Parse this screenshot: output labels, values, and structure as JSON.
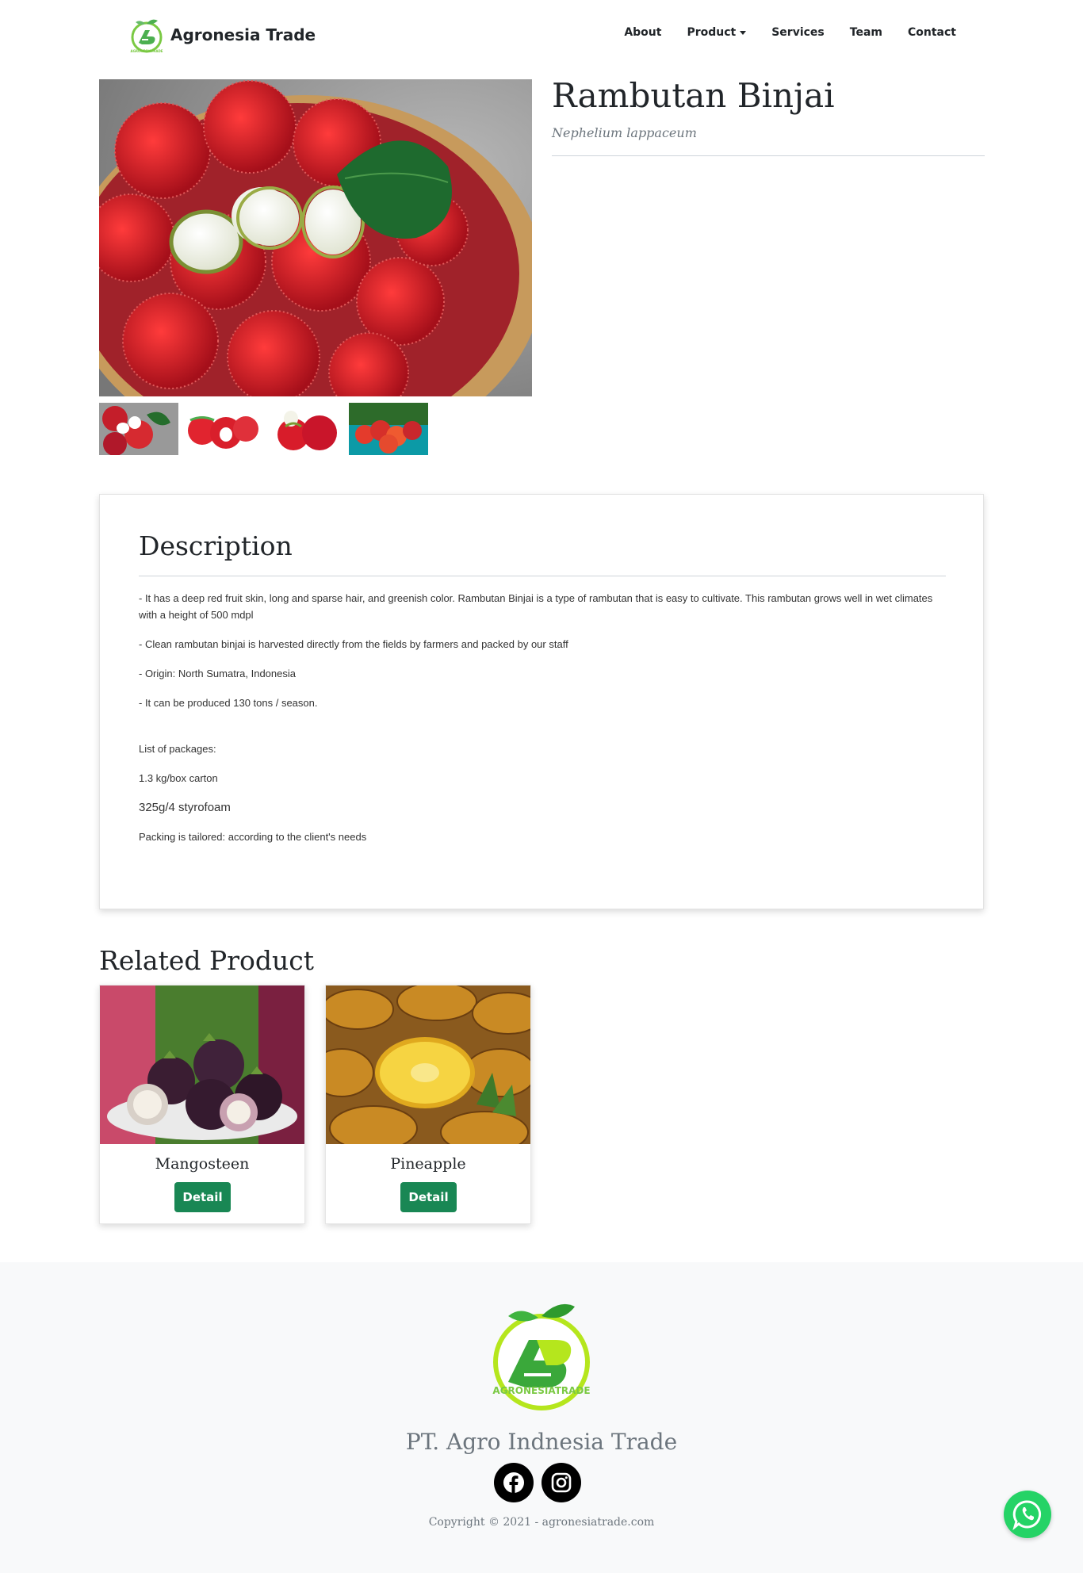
{
  "navbar": {
    "brand_name": "Agronesia Trade",
    "items": [
      {
        "label": "About"
      },
      {
        "label": "Product",
        "dropdown": true
      },
      {
        "label": "Services"
      },
      {
        "label": "Team"
      },
      {
        "label": "Contact"
      }
    ]
  },
  "product": {
    "title": "Rambutan Binjai",
    "latin_name": "Nephelium lappaceum",
    "thumbnails_count": 4
  },
  "description": {
    "heading": "Description",
    "paragraphs": [
      "- It has a deep red fruit skin, long and sparse hair, and greenish color. Rambutan Binjai is a type of rambutan that is easy to cultivate. This rambutan grows well in wet climates with a height of 500 mdpl",
      "- Clean rambutan binjai is harvested directly from the fields by farmers and packed by our staff",
      "- Origin: North Sumatra, Indonesia",
      "- It can be produced 130 tons / season."
    ],
    "packages_title": "List of packages:",
    "packages": [
      "1.3 kg/box carton",
      "325g/4 styrofoam",
      "Packing is tailored: according to the client's needs"
    ]
  },
  "related": {
    "heading": "Related Product",
    "items": [
      {
        "name": "Mangosteen",
        "button": "Detail"
      },
      {
        "name": "Pineapple",
        "button": "Detail"
      }
    ]
  },
  "footer": {
    "logo_text": "AGRONESIATRADE",
    "company": "PT. Agro Indnesia Trade",
    "copyright": "Copyright © 2021 - agronesiatrade.com",
    "socials": [
      "facebook-icon",
      "instagram-icon"
    ]
  },
  "colors": {
    "primary_green": "#198754",
    "brand_green": "#7ac943",
    "whatsapp": "#25d366",
    "footer_bg": "#f8f9fa"
  }
}
